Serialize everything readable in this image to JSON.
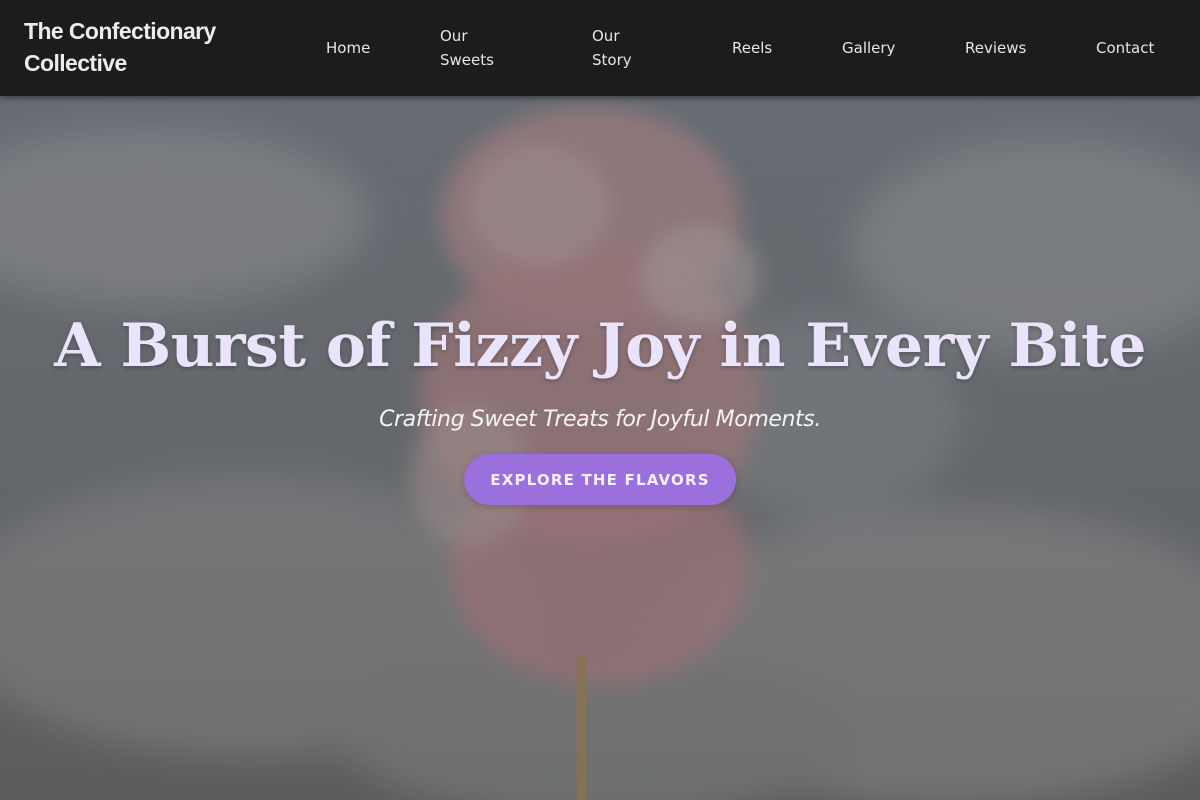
{
  "brand": {
    "line1": "The Confectionary",
    "line2": "Collective"
  },
  "nav": {
    "home": "Home",
    "our_sweets": [
      "Our",
      "Sweets"
    ],
    "our_story": [
      "Our",
      "Story"
    ],
    "reels": "Reels",
    "gallery": "Gallery",
    "reviews": "Reviews",
    "contact": "Contact"
  },
  "hero": {
    "title": "A Burst of Fizzy Joy in Every Bite",
    "subtitle": "Crafting Sweet Treats for Joyful Moments.",
    "cta_label": "EXPLORE THE FLAVORS",
    "image": "cotton-candy-on-stick"
  },
  "colors": {
    "nav_background": "#1c1c1c",
    "title_text": "#e9e3fb",
    "cta_background": "#9b6fdc",
    "cta_text": "#f5f0ff"
  }
}
